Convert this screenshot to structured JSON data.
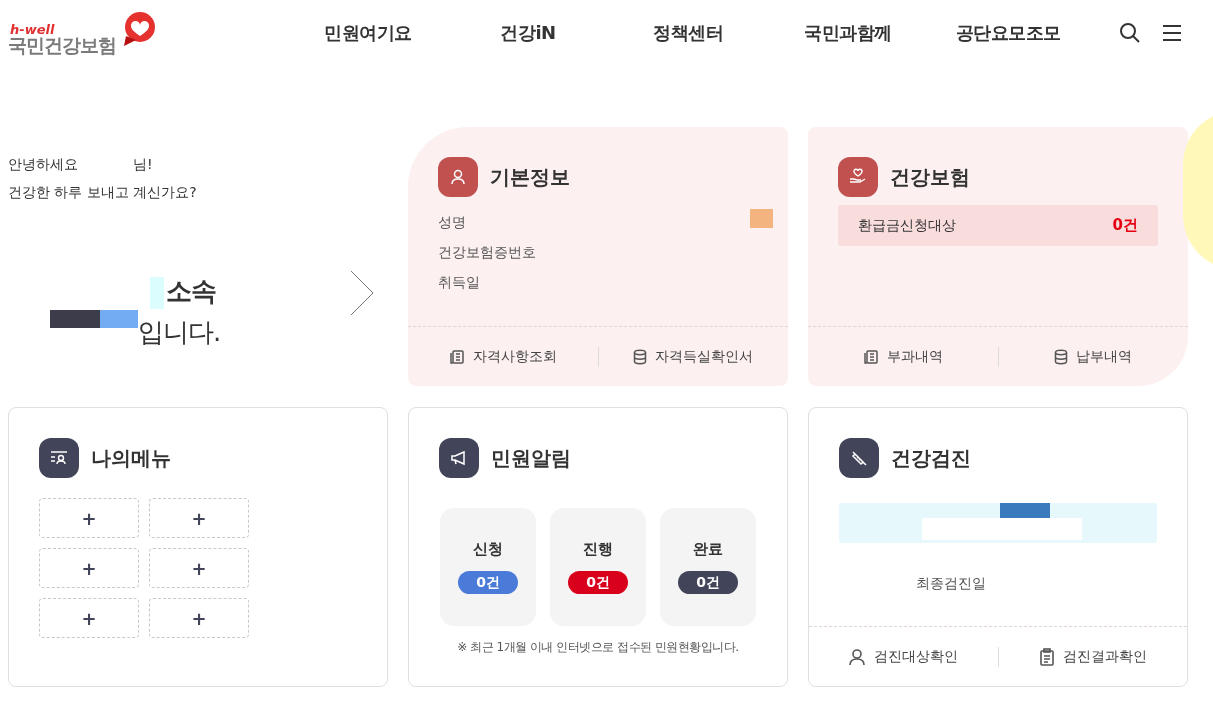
{
  "header": {
    "logo": {
      "tagline": "h-well",
      "name": "국민건강보험"
    },
    "nav": [
      {
        "label": "민원여기요"
      },
      {
        "label": "건강iN"
      },
      {
        "label": "정책센터"
      },
      {
        "label": "국민과함께"
      },
      {
        "label": "공단요모조모"
      }
    ]
  },
  "greeting": {
    "line_1": "안녕하세요",
    "suffix": "님!",
    "line_2": "건강한 하루 보내고 계신가요?",
    "affiliation": "소속",
    "ending": "입니다."
  },
  "basic_info": {
    "title": "기본정보",
    "fields": [
      "성명",
      "건강보험증번호",
      "취득일"
    ],
    "links": [
      {
        "label": "자격사항조회",
        "kind": "document"
      },
      {
        "label": "자격득실확인서",
        "kind": "database"
      }
    ]
  },
  "insurance": {
    "title": "건강보험",
    "refund": {
      "label": "환급금신청대상",
      "count": "0건"
    },
    "links": [
      {
        "label": "부과내역",
        "kind": "document"
      },
      {
        "label": "납부내역",
        "kind": "database"
      }
    ]
  },
  "my_menu": {
    "title": "나의메뉴",
    "slots": [
      "+",
      "+",
      "+",
      "+",
      "+",
      "+"
    ]
  },
  "civil_alerts": {
    "title": "민원알림",
    "statuses": [
      {
        "label": "신청",
        "count": "0건",
        "color": "#4a7bd8"
      },
      {
        "label": "진행",
        "count": "0건",
        "color": "#d9001b"
      },
      {
        "label": "완료",
        "count": "0건",
        "color": "#42455a"
      }
    ],
    "note": "※ 최근 1개월 이내 인터넷으로 접수된 민원현황입니다."
  },
  "checkup": {
    "title": "건강검진",
    "last_date_label": "최종검진일",
    "links": [
      {
        "label": "검진대상확인",
        "kind": "person"
      },
      {
        "label": "검진결과확인",
        "kind": "clipboard"
      }
    ]
  }
}
